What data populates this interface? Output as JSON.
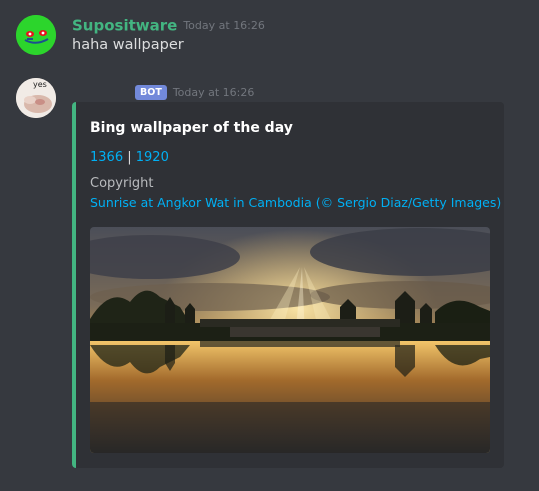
{
  "messages": [
    {
      "username": "Supositware",
      "username_color": "#43b581",
      "timestamp": "Today at 16:26",
      "text": "haha wallpaper"
    },
    {
      "avatar_text": "yes",
      "badge": "BOT",
      "timestamp": "Today at 16:26",
      "embed": {
        "accent_color": "#43b581",
        "title": "Bing wallpaper of the day",
        "link_1366": "1366",
        "separator": "|",
        "link_1920": "1920",
        "field_name": "Copyright",
        "field_value": "Sunrise at Angkor Wat in Cambodia (© Sergio Diaz/Getty Images)",
        "image_icon": "angkor-wat-sunrise-photo"
      }
    }
  ]
}
